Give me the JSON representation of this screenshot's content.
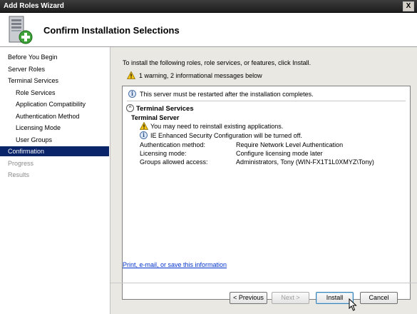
{
  "window": {
    "title": "Add Roles Wizard",
    "close_label": "X"
  },
  "header": {
    "title": "Confirm Installation Selections",
    "icon": "server-add-icon"
  },
  "sidebar": {
    "items": [
      {
        "label": "Before You Begin",
        "state": "normal"
      },
      {
        "label": "Server Roles",
        "state": "normal"
      },
      {
        "label": "Terminal Services",
        "state": "normal"
      },
      {
        "label": "Role Services",
        "state": "sub"
      },
      {
        "label": "Application Compatibility",
        "state": "sub"
      },
      {
        "label": "Authentication Method",
        "state": "sub"
      },
      {
        "label": "Licensing Mode",
        "state": "sub"
      },
      {
        "label": "User Groups",
        "state": "sub"
      },
      {
        "label": "Confirmation",
        "state": "active"
      },
      {
        "label": "Progress",
        "state": "dim"
      },
      {
        "label": "Results",
        "state": "dim"
      }
    ]
  },
  "main": {
    "intro": "To install the following roles, role services, or features, click Install.",
    "summary": "1 warning, 2 informational messages below",
    "restart_message": "This server must be restarted after the installation completes.",
    "section_title": "Terminal Services",
    "subsection_title": "Terminal Server",
    "warning_message": "You may need to reinstall existing applications.",
    "info_message": "IE Enhanced Security Configuration will be turned off.",
    "details": [
      {
        "key": "Authentication method:",
        "value": "Require Network Level Authentication"
      },
      {
        "key": "Licensing mode:",
        "value": "Configure licensing mode later"
      },
      {
        "key": "Groups allowed access:",
        "value": "Administrators, Tony (WIN-FX1T1L0XMYZ\\Tony)"
      }
    ],
    "link": "Print, e-mail, or save this information"
  },
  "buttons": {
    "previous": "< Previous",
    "next": "Next >",
    "install": "Install",
    "cancel": "Cancel"
  }
}
